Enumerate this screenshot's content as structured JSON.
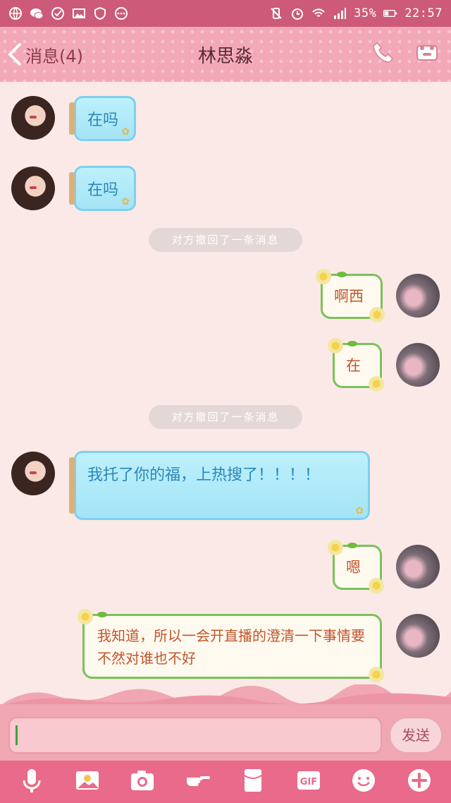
{
  "status_bar": {
    "battery": "35%",
    "time": "22:57"
  },
  "header": {
    "back_label": "消息(4)",
    "title": "林思淼"
  },
  "messages": [
    {
      "side": "left",
      "style": "jar",
      "text": "在吗"
    },
    {
      "side": "left",
      "style": "jar",
      "text": "在吗"
    },
    {
      "type": "recall",
      "text": "对方撤回了一条消息"
    },
    {
      "side": "right",
      "style": "vine",
      "text": "啊西"
    },
    {
      "side": "right",
      "style": "vine",
      "text": "在"
    },
    {
      "type": "recall",
      "text": "对方撤回了一条消息"
    },
    {
      "side": "left",
      "style": "jar",
      "text": "我托了你的福，上热搜了！！！！"
    },
    {
      "side": "right",
      "style": "vine",
      "text": "嗯"
    },
    {
      "side": "right",
      "style": "vine",
      "text": "我知道，所以一会开直播的澄清一下事情要不然对谁也不好"
    }
  ],
  "composer": {
    "input_value": "",
    "send_label": "发送"
  },
  "toolbar": {
    "items": [
      "microphone-icon",
      "image-icon",
      "camera-icon",
      "poke-icon",
      "red-packet-icon",
      "gif-icon",
      "emoji-icon",
      "plus-icon"
    ],
    "gif_label": "GIF"
  },
  "colors": {
    "status_bar": "#cc5a78",
    "header": "#f3a8b8",
    "jar_bubble": "#a4e4f6",
    "vine_border": "#7ac35a",
    "toolbar": "#e96a8a"
  }
}
